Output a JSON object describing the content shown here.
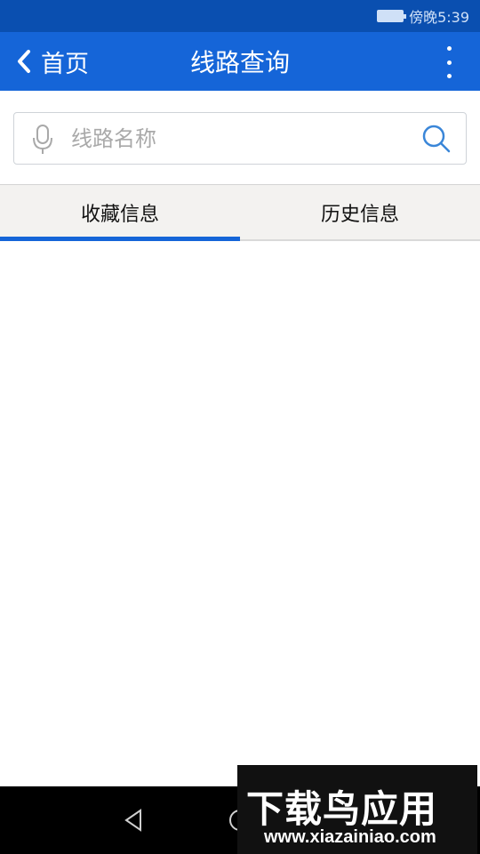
{
  "status_bar": {
    "time": "傍晚5:39",
    "icons": [
      "battery-icon"
    ]
  },
  "app_bar": {
    "back_label": "首页",
    "title": "线路查询",
    "icons": [
      "chevron-left-icon",
      "more-vertical-icon"
    ]
  },
  "search": {
    "placeholder": "线路名称",
    "value": "",
    "icons": [
      "microphone-icon",
      "search-icon"
    ]
  },
  "tabs": [
    {
      "label": "收藏信息",
      "active": true
    },
    {
      "label": "历史信息",
      "active": false
    }
  ],
  "nav_bar": {
    "icons": [
      "nav-back-icon",
      "nav-home-icon"
    ]
  },
  "watermark": {
    "logo_text": "下载鸟应用",
    "url": "www.xiazainiao.com"
  },
  "colors": {
    "status_bar": "#0a4fb0",
    "primary": "#1565d8",
    "tab_background": "#f3f2f0",
    "watermark_green": "#8fd14f"
  }
}
